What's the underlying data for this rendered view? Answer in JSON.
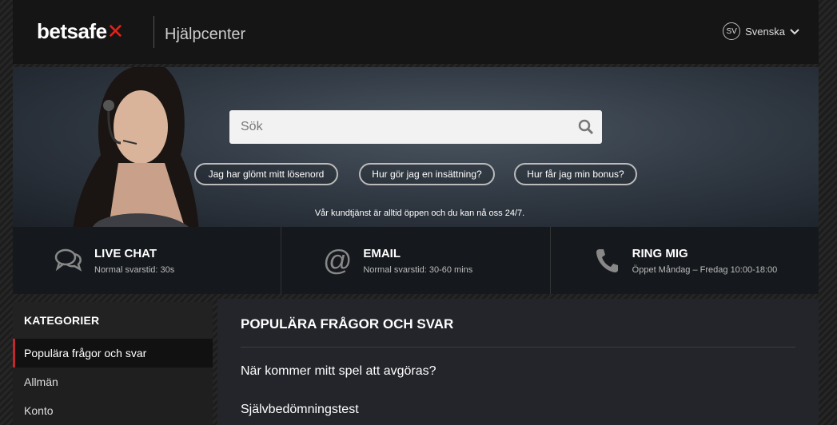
{
  "header": {
    "logo_text": "betsafe",
    "title": "Hjälpcenter",
    "lang_code": "SV",
    "lang_label": "Svenska"
  },
  "hero": {
    "search_placeholder": "Sök",
    "quick_links": [
      "Jag har glömt mitt lösenord",
      "Hur gör jag en insättning?",
      "Hur får jag min bonus?"
    ],
    "note": "Vår kundtjänst är alltid öppen och du kan nå oss 24/7."
  },
  "contacts": [
    {
      "title": "LIVE CHAT",
      "sub": "Normal svarstid: 30s",
      "icon": "chat-icon"
    },
    {
      "title": "EMAIL",
      "sub": "Normal svarstid: 30-60 mins",
      "icon": "at-icon"
    },
    {
      "title": "RING MIG",
      "sub": "Öppet Måndag – Fredag 10:00-18:00",
      "icon": "phone-icon"
    }
  ],
  "sidebar": {
    "heading": "KATEGORIER",
    "items": [
      "Populära frågor och svar",
      "Allmän",
      "Konto"
    ]
  },
  "main": {
    "title": "POPULÄRA FRÅGOR OCH SVAR",
    "faqs": [
      "När kommer mitt spel att avgöras?",
      "Självbedömningstest"
    ]
  },
  "colors": {
    "brand_red": "#e0231b",
    "active_bar": "#c1272d"
  }
}
